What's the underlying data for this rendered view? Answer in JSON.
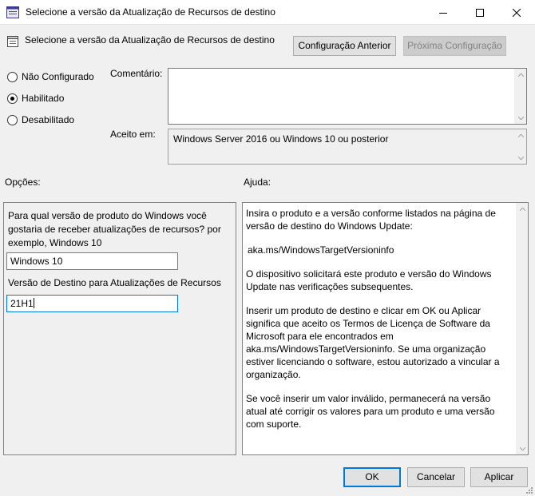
{
  "window": {
    "title": "Selecione a versão da Atualização de Recursos de destino"
  },
  "header": {
    "title": "Selecione a versão da Atualização de Recursos de destino",
    "prev_button": "Configuração Anterior",
    "next_button": "Próxima Configuração"
  },
  "state": {
    "options": [
      {
        "label": "Não Configurado",
        "selected": false
      },
      {
        "label": "Habilitado",
        "selected": true
      },
      {
        "label": "Desabilitado",
        "selected": false
      }
    ]
  },
  "comment": {
    "label": "Comentário:",
    "value": ""
  },
  "supported": {
    "label": "Aceito em:",
    "value": "Windows Server 2016 ou Windows 10 ou posterior"
  },
  "options_section": {
    "label": "Opções:",
    "product_prompt": "Para qual versão de produto do Windows você gostaria de receber atualizações de recursos? por exemplo, Windows 10",
    "product_value": "Windows 10",
    "target_label": "Versão de Destino para Atualizações de Recursos",
    "target_value": "21H1"
  },
  "help_section": {
    "label": "Ajuda:",
    "paragraphs": [
      "Insira o produto e a versão conforme listados na página de versão de destino do Windows Update:",
      "aka.ms/WindowsTargetVersioninfo",
      "O dispositivo solicitará este produto e versão do Windows Update nas verificações subsequentes.",
      "Inserir um produto de destino e clicar em OK ou Aplicar significa que aceito os Termos de Licença de Software da Microsoft para ele encontrados em aka.ms/WindowsTargetVersioninfo. Se uma organização estiver licenciando o software, estou autorizado a vincular a organização.",
      "Se você inserir um valor inválido, permanecerá na versão atual até corrigir os valores para um produto e uma versão com suporte."
    ]
  },
  "footer": {
    "ok": "OK",
    "cancel": "Cancelar",
    "apply": "Aplicar"
  },
  "colors": {
    "accent": "#0078d7",
    "dialog_bg": "#f0f0f0"
  }
}
